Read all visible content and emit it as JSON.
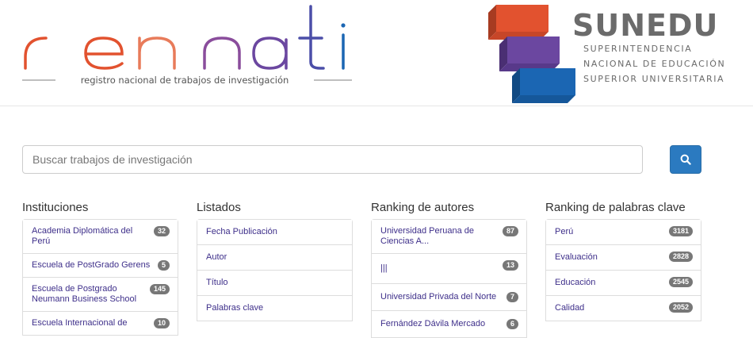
{
  "header": {
    "renati": {
      "wordmark": "renati",
      "tagline": "registro nacional de trabajos de investigación"
    },
    "sunedu": {
      "name": "SUNEDU",
      "lines": [
        "SUPERINTENDENCIA",
        "NACIONAL DE EDUCACIÓN",
        "SUPERIOR UNIVERSITARIA"
      ]
    },
    "colors": {
      "orange": "#e2522f",
      "purple": "#6b47a0",
      "blue": "#1b66b3",
      "gray": "#6b6b6b"
    }
  },
  "search": {
    "placeholder": "Buscar trabajos de investigación",
    "button_icon": "search-icon",
    "button_color": "#2b7ac0"
  },
  "columns": [
    {
      "title": "Instituciones",
      "items": [
        {
          "label": "Academia Diplomática del Perú",
          "badge": "32"
        },
        {
          "label": "Escuela de PostGrado Gerens",
          "badge": "5"
        },
        {
          "label": "Escuela de Postgrado Neumann Business School",
          "badge": "145"
        },
        {
          "label": "Escuela Internacional de",
          "badge": "10"
        }
      ]
    },
    {
      "title": "Listados",
      "items": [
        {
          "label": "Fecha Publicación"
        },
        {
          "label": "Autor"
        },
        {
          "label": "Título"
        },
        {
          "label": "Palabras clave"
        }
      ]
    },
    {
      "title": "Ranking de autores",
      "items": [
        {
          "label": "Universidad Peruana de Ciencias A...",
          "badge": "87"
        },
        {
          "label": "|||",
          "badge": "13"
        },
        {
          "label": "Universidad Privada del Norte",
          "badge": "7"
        },
        {
          "label": "Fernández Dávila Mercado",
          "badge": "6"
        }
      ]
    },
    {
      "title": "Ranking de palabras clave",
      "items": [
        {
          "label": "Perú",
          "badge": "3181"
        },
        {
          "label": "Evaluación",
          "badge": "2828"
        },
        {
          "label": "Educación",
          "badge": "2545"
        },
        {
          "label": "Calidad",
          "badge": "2052"
        }
      ]
    }
  ]
}
